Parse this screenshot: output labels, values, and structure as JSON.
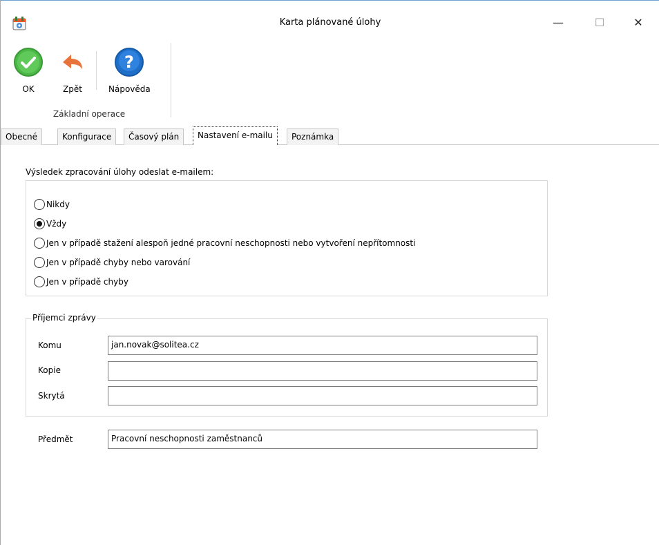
{
  "window": {
    "title": "Karta plánované úlohy",
    "minimize_icon": "—",
    "maximize_icon": "☐",
    "close_icon": "✕"
  },
  "ribbon": {
    "ok_label": "OK",
    "back_label": "Zpět",
    "help_label": "Nápověda",
    "group_label": "Základní operace",
    "colors": {
      "ok": "#4cb848",
      "back": "#e9733a",
      "help": "#1f6fc8"
    }
  },
  "tabs": [
    {
      "label": "Obecné"
    },
    {
      "label": "Konfigurace"
    },
    {
      "label": "Časový plán"
    },
    {
      "label": "Nastavení e-mailu",
      "active": true
    },
    {
      "label": "Poznámka"
    }
  ],
  "email": {
    "section_label": "Výsledek zpracování úlohy odeslat e-mailem:",
    "options": [
      {
        "label": "Nikdy",
        "checked": false
      },
      {
        "label": "Vždy",
        "checked": true
      },
      {
        "label": "Jen v případě stažení alespoň jedné pracovní neschopnosti nebo vytvoření nepřítomnosti",
        "checked": false
      },
      {
        "label": "Jen v případě chyby nebo varování",
        "checked": false
      },
      {
        "label": "Jen v případě chyby",
        "checked": false
      }
    ]
  },
  "recipients": {
    "legend": "Příjemci zprávy",
    "to_label": "Komu",
    "to_value": "jan.novak@solitea.cz",
    "cc_label": "Kopie",
    "cc_value": "",
    "bcc_label": "Skrytá",
    "bcc_value": ""
  },
  "subject": {
    "label": "Předmět",
    "value": "Pracovní neschopnosti zaměstnanců"
  }
}
